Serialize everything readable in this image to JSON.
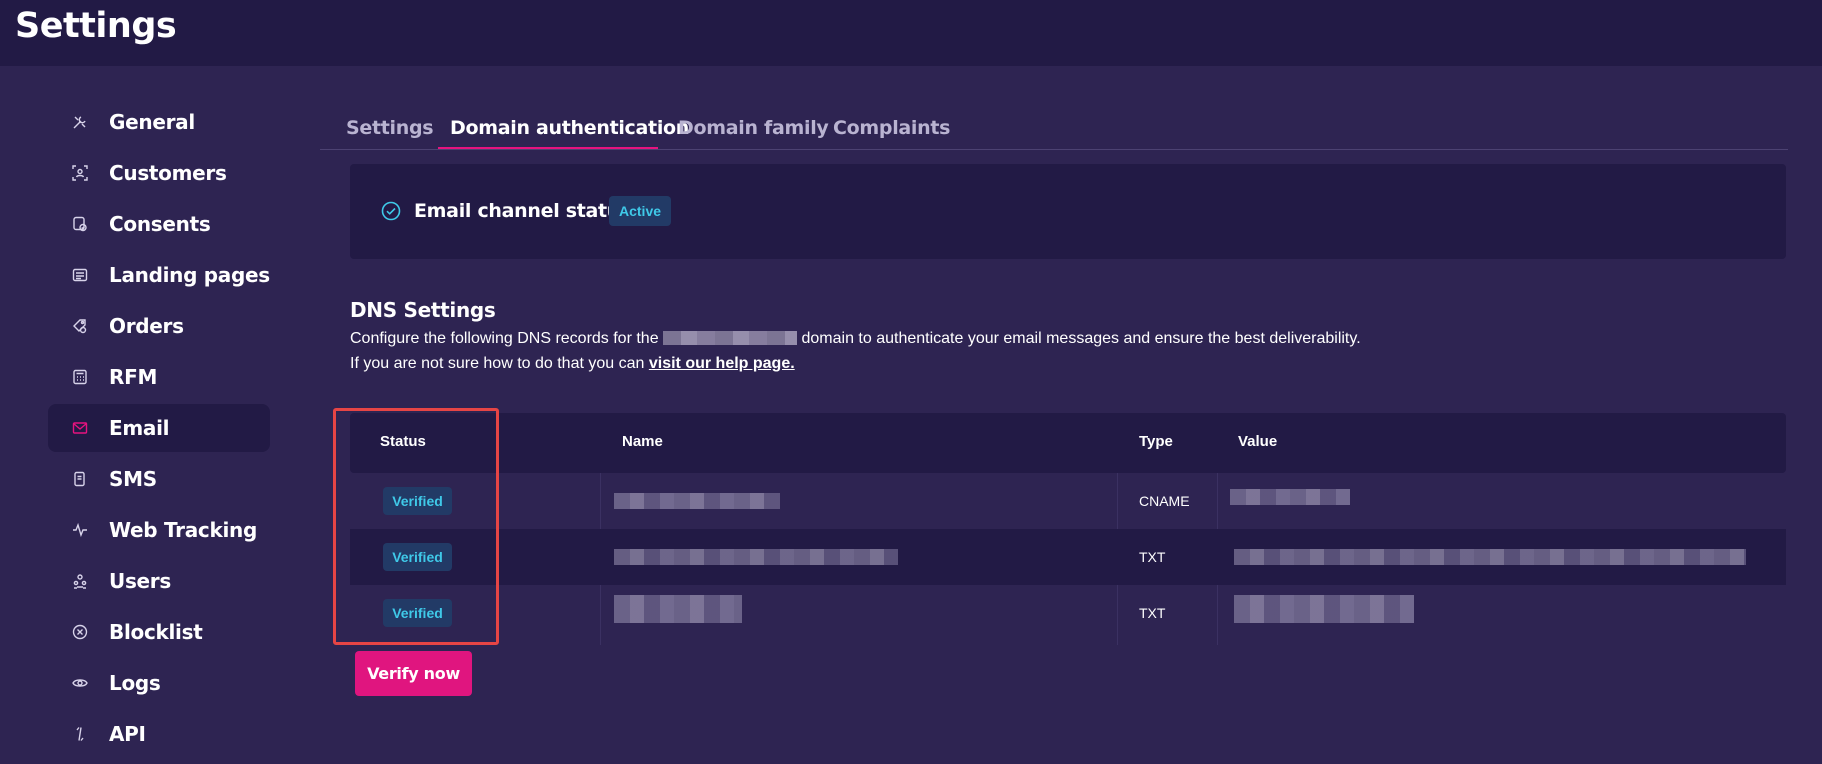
{
  "header": {
    "title": "Settings"
  },
  "sidebar": {
    "items": [
      {
        "label": "General",
        "icon": "tools-icon"
      },
      {
        "label": "Customers",
        "icon": "customer-icon"
      },
      {
        "label": "Consents",
        "icon": "consent-icon"
      },
      {
        "label": "Landing pages",
        "icon": "landing-page-icon"
      },
      {
        "label": "Orders",
        "icon": "orders-icon"
      },
      {
        "label": "RFM",
        "icon": "rfm-icon"
      },
      {
        "label": "Email",
        "icon": "email-icon",
        "active": true
      },
      {
        "label": "SMS",
        "icon": "sms-icon"
      },
      {
        "label": "Web Tracking",
        "icon": "web-tracking-icon"
      },
      {
        "label": "Users",
        "icon": "users-icon"
      },
      {
        "label": "Blocklist",
        "icon": "blocklist-icon"
      },
      {
        "label": "Logs",
        "icon": "eye-icon"
      },
      {
        "label": "API",
        "icon": "api-icon"
      }
    ]
  },
  "tabs": [
    {
      "label": "Settings"
    },
    {
      "label": "Domain authentication",
      "active": true
    },
    {
      "label": "Domain family"
    },
    {
      "label": "Complaints"
    }
  ],
  "status_card": {
    "label": "Email channel status",
    "badge": "Active"
  },
  "dns": {
    "title": "DNS Settings",
    "desc_before": "Configure the following DNS records for the",
    "desc_after": "domain to authenticate your email messages and ensure the best deliverability.",
    "help_before": "If you are not sure how to do that you can",
    "help_link": "visit our help page."
  },
  "table": {
    "headers": {
      "status": "Status",
      "name": "Name",
      "type": "Type",
      "value": "Value"
    },
    "rows": [
      {
        "status": "Verified",
        "type": "CNAME"
      },
      {
        "status": "Verified",
        "type": "TXT"
      },
      {
        "status": "Verified",
        "type": "TXT"
      }
    ]
  },
  "actions": {
    "verify_label": "Verify now"
  },
  "colors": {
    "background": "#2e2452",
    "panel": "#221a45",
    "accent": "#e6137f",
    "badge_text": "#3fc9e8",
    "highlight": "#e64545"
  }
}
